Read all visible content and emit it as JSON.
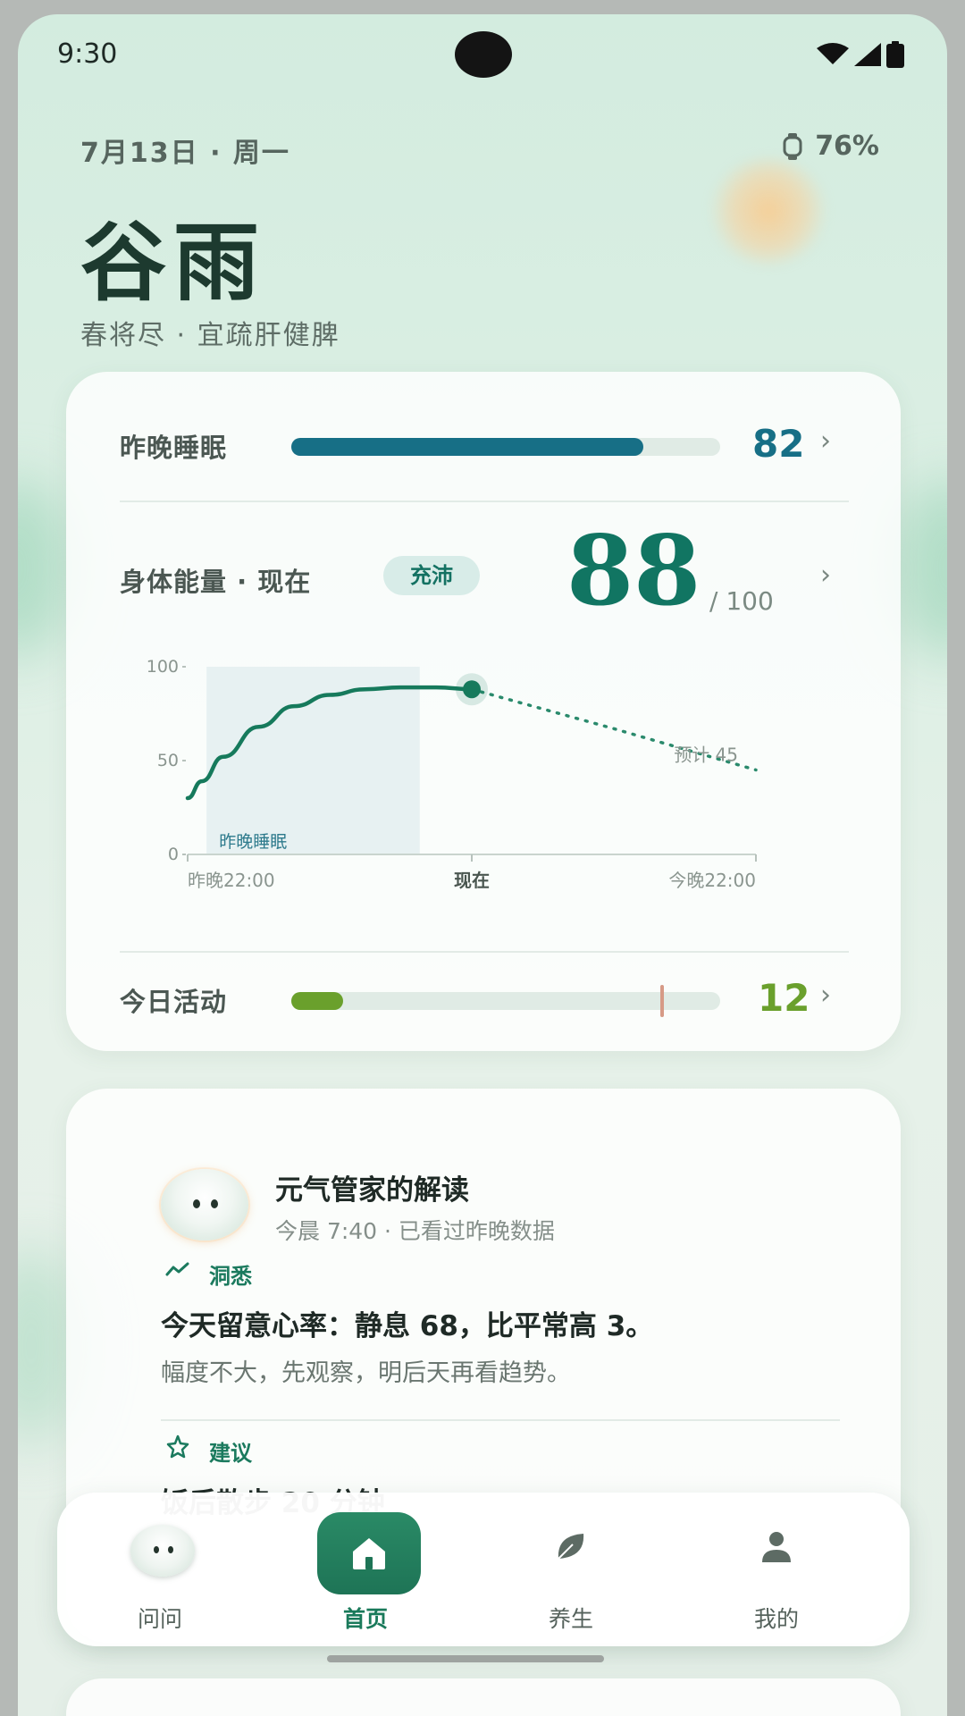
{
  "status_bar": {
    "time": "9:30"
  },
  "header": {
    "date": "7月13日 · 周一",
    "watch_battery": "76%",
    "solar_term": "谷雨",
    "tagline": "春将尽 · 宜疏肝健脾"
  },
  "sleep": {
    "label": "昨晚睡眠",
    "score": "82",
    "progress": 0.82,
    "color": "#176f86"
  },
  "energy": {
    "label": "身体能量 · 现在",
    "badge": "充沛",
    "value": "88",
    "max_text": "/ 100",
    "color": "#117562"
  },
  "chart_data": {
    "type": "line",
    "y_ticks": [
      "100",
      "50",
      "0"
    ],
    "ylim": [
      0,
      100
    ],
    "x_ticks": [
      "昨晚22:00",
      "现在",
      "今晚22:00"
    ],
    "sleep_band_label": "昨晚睡眠",
    "forecast_label": "预计 45",
    "series": [
      {
        "values_x_hours": [
          0,
          0.6,
          1.5,
          3,
          4.5,
          6,
          7.5,
          9,
          10.5,
          12
        ],
        "values_y": [
          30,
          39,
          52,
          68,
          79,
          85,
          88,
          89,
          89,
          88
        ]
      },
      {
        "values_x_hours": [
          12,
          18,
          24
        ],
        "values_y": [
          88,
          67,
          45
        ]
      }
    ]
  },
  "activity": {
    "label": "今日活动",
    "score": "12",
    "progress": 0.12,
    "goal_marker": 0.86,
    "color": "#6aa02c"
  },
  "ai_card": {
    "title": "元气管家的解读",
    "subtitle": "今晨 7:40 · 已看过昨晚数据",
    "insight_label": "洞悉",
    "insight_text": "今天留意心率：静息 68，比平常高 3。",
    "insight_detail": "幅度不大，先观察，明后天再看趋势。",
    "advice_label": "建议",
    "advice_text": "饭后散步 20 分钟"
  },
  "nav": {
    "items": [
      {
        "label": "问问",
        "icon": "assistant-avatar-icon"
      },
      {
        "label": "首页",
        "icon": "home-icon"
      },
      {
        "label": "养生",
        "icon": "leaf-icon"
      },
      {
        "label": "我的",
        "icon": "person-icon"
      }
    ]
  }
}
